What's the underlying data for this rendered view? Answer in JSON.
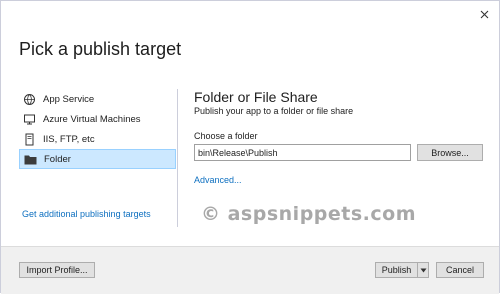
{
  "dialog": {
    "title": "Pick a publish target",
    "close_icon": "close-icon"
  },
  "targets": [
    {
      "label": "App Service",
      "icon": "cloud-globe-icon",
      "selected": false
    },
    {
      "label": "Azure Virtual Machines",
      "icon": "virtual-machine-icon",
      "selected": false
    },
    {
      "label": "IIS, FTP, etc",
      "icon": "server-icon",
      "selected": false
    },
    {
      "label": "Folder",
      "icon": "folder-icon",
      "selected": true
    }
  ],
  "get_more_link": "Get additional publishing targets",
  "detail": {
    "title": "Folder or File Share",
    "subtitle": "Publish your app to a folder or file share",
    "folder_label": "Choose a folder",
    "folder_value": "bin\\Release\\Publish",
    "browse_label": "Browse...",
    "advanced_link": "Advanced..."
  },
  "watermark": "© aspsnippets.com",
  "footer": {
    "import_label": "Import Profile...",
    "publish_label": "Publish",
    "publish_dropdown_icon": "caret-down-icon",
    "cancel_label": "Cancel"
  },
  "colors": {
    "accent_link": "#0e70c0",
    "selection_bg": "#cce8ff",
    "footer_bg": "#f0f0f0"
  }
}
